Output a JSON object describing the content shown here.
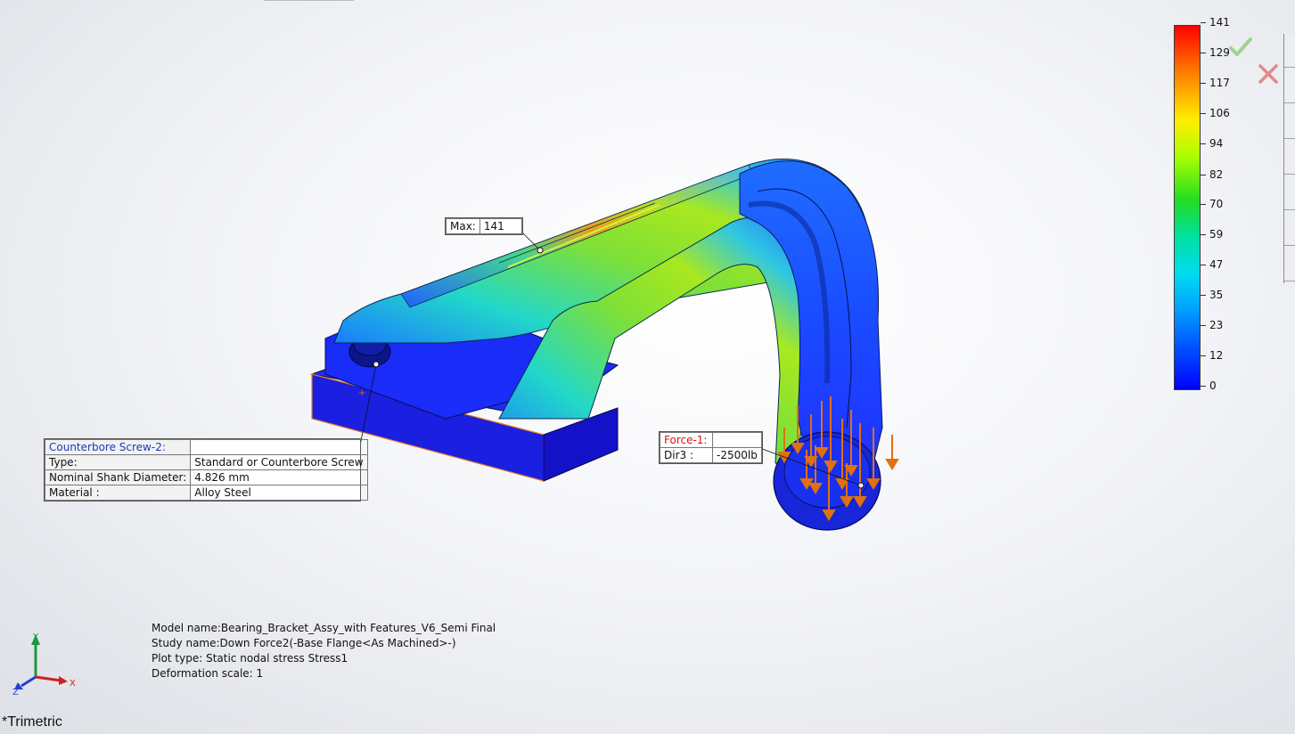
{
  "legend": {
    "ticks": [
      "141",
      "129",
      "117",
      "106",
      "94",
      "82",
      "70",
      "59",
      "47",
      "35",
      "23",
      "12",
      "0"
    ],
    "colors": {
      "max": "#ff0000",
      "mid": "#22dd22",
      "min": "#0000ff"
    }
  },
  "icons": {
    "ok": "green-checkmark-icon",
    "cancel": "red-x-icon"
  },
  "max_callout": {
    "label": "Max:",
    "value": "141"
  },
  "screw_callout": {
    "title": "Counterbore Screw-2:",
    "rows": [
      {
        "key": "Type:",
        "value": "Standard or Counterbore Screw"
      },
      {
        "key": "Nominal Shank Diameter:",
        "value": "4.826 mm"
      },
      {
        "key": "Material :",
        "value": "Alloy Steel"
      }
    ]
  },
  "force_callout": {
    "title": "Force-1:",
    "dir_label": "Dir3 :",
    "dir_value": "-2500lb"
  },
  "info": {
    "model": "Model name:Bearing_Bracket_Assy_with Features_V6_Semi Final",
    "study": "Study name:Down Force2(-Base Flange<As Machined>-)",
    "plot": "Plot type: Static nodal stress Stress1",
    "scale": "Deformation scale: 1"
  },
  "triad": {
    "x": "X",
    "y": "Y",
    "z": "Z"
  },
  "view_label": "*Trimetric"
}
